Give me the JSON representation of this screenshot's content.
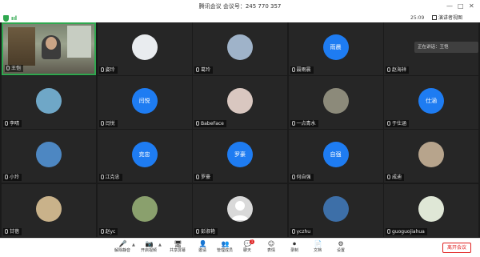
{
  "window": {
    "title": "腾讯会议 会议号：245 770 357",
    "minimize": "—",
    "maximize": "□",
    "close": "✕"
  },
  "toolbar": {
    "signal": "ııl",
    "timer": "25:09",
    "view_label": "演讲者视图"
  },
  "side_panel": {
    "label": "正在讲话：王恺"
  },
  "participants": [
    {
      "name": "王恺",
      "type": "webcam",
      "speaking": true
    },
    {
      "name": "姿玲",
      "type": "photo",
      "photo_color": "#e9ecef"
    },
    {
      "name": "葛玲",
      "type": "photo",
      "photo_color": "#9fb3c9"
    },
    {
      "name": "聂雨晨",
      "type": "blue",
      "avatar_text": "雨晨"
    },
    {
      "name": "赵海祥",
      "type": "empty"
    },
    {
      "name": "李晴",
      "type": "photo",
      "photo_color": "#6fa7c7"
    },
    {
      "name": "闫悦",
      "type": "blue",
      "avatar_text": "闫悦"
    },
    {
      "name": "BabeFace",
      "type": "photo",
      "photo_color": "#d9c7c0"
    },
    {
      "name": "一点青水",
      "type": "photo",
      "photo_color": "#8c8a7a"
    },
    {
      "name": "于仕涵",
      "type": "blue",
      "avatar_text": "仕涵"
    },
    {
      "name": "小玲",
      "type": "photo",
      "photo_color": "#4d87c2"
    },
    {
      "name": "江克忠",
      "type": "blue",
      "avatar_text": "克忠"
    },
    {
      "name": "罗豪",
      "type": "blue",
      "avatar_text": "罗豪"
    },
    {
      "name": "何自强",
      "type": "blue",
      "avatar_text": "自强"
    },
    {
      "name": "成迪",
      "type": "photo",
      "photo_color": "#b7a48c"
    },
    {
      "name": "甘蓓",
      "type": "photo",
      "photo_color": "#c9b28a"
    },
    {
      "name": "赵yc",
      "type": "photo",
      "photo_color": "#8aa06d"
    },
    {
      "name": "彭淑艳",
      "type": "gray"
    },
    {
      "name": "yczhu",
      "type": "photo",
      "photo_color": "#3d6fa8"
    },
    {
      "name": "guoguojiahua",
      "type": "photo",
      "photo_color": "#dfe7d6"
    }
  ],
  "bottom_bar": {
    "items": [
      {
        "label": "解除静音",
        "icon": "🎤"
      },
      {
        "label": "开启视频",
        "icon": "📷"
      },
      {
        "label": "共享屏幕",
        "icon": "🖥"
      },
      {
        "label": "邀请",
        "icon": "👤"
      },
      {
        "label": "管理成员",
        "icon": "👥"
      },
      {
        "label": "聊天",
        "icon": "💬"
      },
      {
        "label": "表情",
        "icon": "☺"
      },
      {
        "label": "录制",
        "icon": "⏺"
      },
      {
        "label": "文档",
        "icon": "📄"
      },
      {
        "label": "设置",
        "icon": "⚙"
      }
    ],
    "chat_badge": "1",
    "leave_label": "离开会议"
  },
  "colors": {
    "speaking_border": "#2fa84f",
    "avatar_blue": "#1e7cf2",
    "leave_red": "#e02020"
  }
}
